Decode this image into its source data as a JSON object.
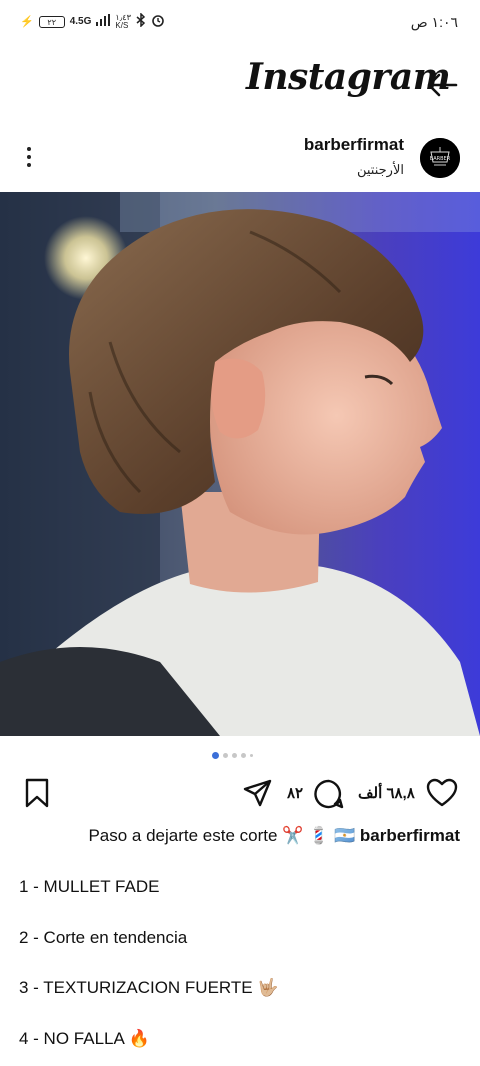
{
  "status_bar": {
    "network": "4.5G",
    "battery": "٢٢",
    "speed": "١٫٤٣\nK/S",
    "time": "١:٠٦ ص"
  },
  "header": {
    "app_title": "Instagram"
  },
  "post": {
    "username": "barberfirmat",
    "location": "الأرجنتين",
    "avatar_text": "BARBER",
    "likes": "٦٨,٨ ألف",
    "comments": "٨٢",
    "caption_user": "barberfirmat",
    "caption_text": "Paso a dejarte este corte ✂️ 💈 🇦🇷",
    "lines": [
      "1 - MULLET FADE",
      "2 - Corte en tendencia",
      "3 - TEXTURIZACION FUERTE 🤟🏼",
      "4 - NO FALLA 🔥"
    ]
  }
}
